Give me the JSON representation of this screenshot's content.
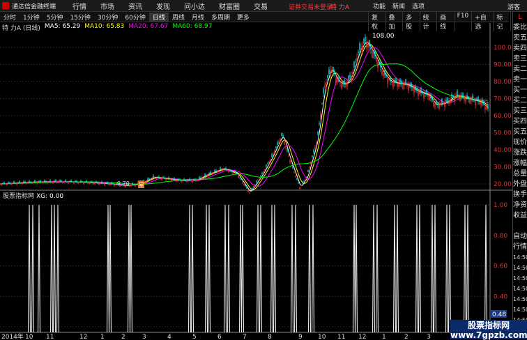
{
  "app": {
    "title": "通达信金融终端"
  },
  "menu": [
    "行情",
    "市场",
    "资讯",
    "发现",
    "问小达",
    "财富圈",
    "交易"
  ],
  "alert": {
    "login": "证券交易未登录",
    "stock": "特 力A"
  },
  "right_menu": [
    "功能",
    "新闻",
    "选项"
  ],
  "guest": "游客",
  "periods": [
    "分时",
    "1分钟",
    "5分钟",
    "15分钟",
    "30分钟",
    "60分钟",
    "日线",
    "周线",
    "月线",
    "多周期",
    "更多"
  ],
  "active_period": "日线",
  "tools": [
    "复权",
    "叠加",
    "多股",
    "统计",
    "画线",
    "F10",
    "+自选",
    "标记",
    "<<"
  ],
  "stock_line": {
    "name": "特 力A (日线)"
  },
  "ma": [
    {
      "label": "MA5: 65.29",
      "color": "#ffffff"
    },
    {
      "label": "MA10: 65.83",
      "color": "#ffff00"
    },
    {
      "label": "MA20: 67.67",
      "color": "#ff00ff"
    },
    {
      "label": "MA60: 68.97",
      "color": "#00ff00"
    }
  ],
  "indicator": {
    "name": "股票指标网",
    "xg": "XG: 0.00",
    "current_value": "0.48"
  },
  "price_axis": [
    "100.0",
    "90.00",
    "80.00",
    "70.00",
    "60.00",
    "50.00",
    "40.00",
    "30.00",
    "20.00"
  ],
  "indicator_axis": [
    "1.00",
    "0.80",
    "0.60",
    "0.40",
    "0.20"
  ],
  "x_axis": [
    "2014年",
    "10",
    "11",
    "12",
    "1",
    "2",
    "3",
    "4",
    "5",
    "6",
    "7",
    "8",
    "9",
    "10",
    "11",
    "12",
    "1",
    "2",
    "3",
    "4"
  ],
  "annotations": {
    "high": "108.00",
    "low": "9.70",
    "tag": "星"
  },
  "sidebar": [
    "委比",
    "卖五",
    "卖四",
    "卖三",
    "卖二",
    "卖一",
    "买一",
    "买二",
    "买三",
    "买四",
    "买五",
    "现价",
    "涨跌",
    "涨幅",
    "总量",
    "外盘",
    "换手",
    "净资",
    "收益",
    "",
    "自动",
    "行情",
    "14:50",
    "14:50",
    "14:50",
    "14:50",
    "14:50",
    "14:50",
    "14:50",
    "14:50"
  ],
  "watermark": {
    "line1": "股票指标网",
    "line2": "www.7gpzb.com"
  }
}
